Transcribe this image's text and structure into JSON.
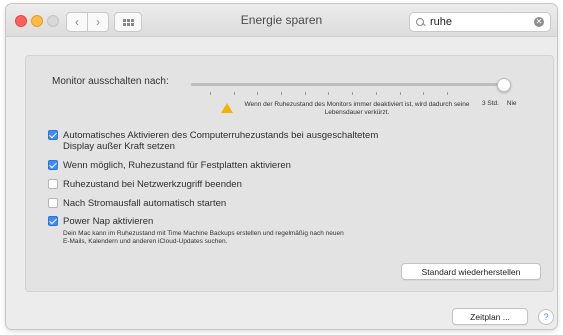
{
  "window": {
    "title": "Energie sparen"
  },
  "toolbar": {
    "back_icon": "chevron-left-icon",
    "forward_icon": "chevron-right-icon",
    "grid_icon": "grid-icon"
  },
  "search": {
    "value": "ruhe",
    "icon": "search-icon",
    "clear_icon": "clear-icon"
  },
  "monitor": {
    "label": "Monitor ausschalten nach:",
    "level_percent": 100,
    "warning_text": "Wenn der Ruhezustand des Monitors immer deaktiviert ist, wird dadurch seine Lebensdauer verkürzt.",
    "end_label_1": "3 Std.",
    "end_label_2": "Nie"
  },
  "options": [
    {
      "label": "Automatisches Aktivieren des Computerruhezustands bei ausgeschaltetem",
      "label2": "Display außer Kraft setzen",
      "checked": true
    },
    {
      "label": "Wenn möglich, Ruhezustand für Festplatten aktivieren",
      "checked": true
    },
    {
      "label": "Ruhezustand bei Netzwerkzugriff beenden",
      "checked": false
    },
    {
      "label": "Nach Stromausfall automatisch starten",
      "checked": false
    },
    {
      "label": "Power Nap aktivieren",
      "checked": true,
      "description1": "Dein Mac kann im Ruhezustand mit Time Machine Backups erstellen und regelmäßig nach neuen",
      "description2": "E-Mails, Kalendern und anderen iCloud-Updates suchen."
    }
  ],
  "buttons": {
    "restore": "Standard wiederherstellen",
    "schedule": "Zeitplan ...",
    "help": "?"
  },
  "colors": {
    "accent": "#3d8bf5",
    "warning": "#f2b400"
  }
}
